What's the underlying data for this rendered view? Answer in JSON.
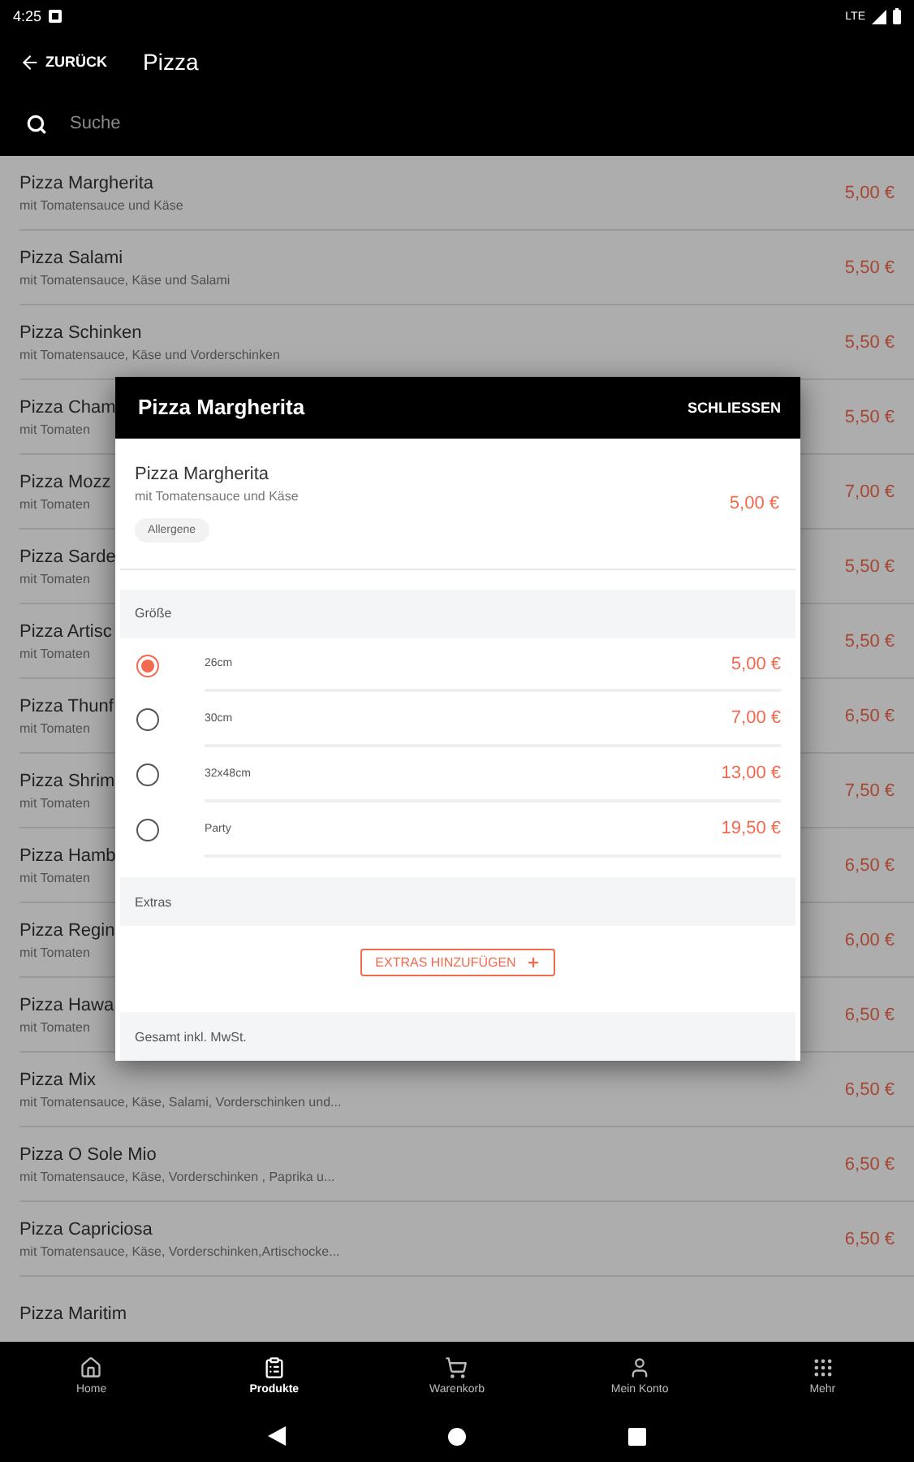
{
  "status_bar": {
    "time": "4:25",
    "network": "LTE"
  },
  "header": {
    "back": "ZURÜCK",
    "title": "Pizza"
  },
  "search": {
    "placeholder": "Suche"
  },
  "products": [
    {
      "name": "Pizza Margherita",
      "description": "mit Tomatensauce und Käse",
      "price": "5,00 €"
    },
    {
      "name": "Pizza Salami",
      "description": "mit Tomatensauce, Käse und Salami",
      "price": "5,50 €"
    },
    {
      "name": "Pizza Schinken",
      "description": "mit Tomatensauce, Käse und Vorderschinken",
      "price": "5,50 €"
    },
    {
      "name": "Pizza Cham",
      "description": "mit Tomaten",
      "price": "5,50 €"
    },
    {
      "name": "Pizza Mozz",
      "description": "mit Tomaten",
      "price": "7,00 €"
    },
    {
      "name": "Pizza Sarde",
      "description": "mit Tomaten",
      "price": "5,50 €"
    },
    {
      "name": "Pizza Artisc",
      "description": "mit Tomaten",
      "price": "5,50 €"
    },
    {
      "name": "Pizza Thunf",
      "description": "mit Tomaten",
      "price": "6,50 €"
    },
    {
      "name": "Pizza Shrim",
      "description": "mit Tomaten",
      "price": "7,50 €"
    },
    {
      "name": "Pizza Hamb",
      "description": "mit Tomaten",
      "price": "6,50 €"
    },
    {
      "name": "Pizza Regin",
      "description": "mit Tomaten",
      "price": "6,00 €"
    },
    {
      "name": "Pizza Hawa",
      "description": "mit Tomaten",
      "price": "6,50 €"
    },
    {
      "name": "Pizza Mix",
      "description": "mit Tomatensauce, Käse, Salami, Vorderschinken und...",
      "price": "6,50 €"
    },
    {
      "name": "Pizza O Sole Mio",
      "description": "mit Tomatensauce, Käse, Vorderschinken , Paprika u...",
      "price": "6,50 €"
    },
    {
      "name": "Pizza Capriciosa",
      "description": "mit Tomatensauce, Käse, Vorderschinken,Artischocke...",
      "price": "6,50 €"
    },
    {
      "name": "Pizza Maritim"
    }
  ],
  "dialog": {
    "title": "Pizza Margherita",
    "close": "SCHLIESSEN",
    "item": {
      "name": "Pizza Margherita",
      "description": "mit Tomatensauce und Käse",
      "tag": "Allergene",
      "price": "5,00 €"
    },
    "size_heading": "Größe",
    "sizes": [
      {
        "label": "26cm",
        "price": "5,00 €",
        "selected": true
      },
      {
        "label": "30cm",
        "price": "7,00 €",
        "selected": false
      },
      {
        "label": "32x48cm",
        "price": "13,00 €",
        "selected": false
      },
      {
        "label": "Party",
        "price": "19,50 €",
        "selected": false
      }
    ],
    "extras_heading": "Extras",
    "extras_button": "EXTRAS HINZUFÜGEN",
    "total_label": "Gesamt inkl. MwSt."
  },
  "bottom_nav": [
    {
      "label": "Home",
      "selected": false
    },
    {
      "label": "Produkte",
      "selected": true
    },
    {
      "label": "Warenkorb",
      "selected": false
    },
    {
      "label": "Mein Konto",
      "selected": false
    },
    {
      "label": "Mehr",
      "selected": false
    }
  ]
}
